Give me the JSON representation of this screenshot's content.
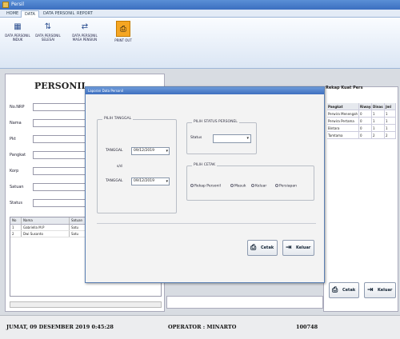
{
  "window": {
    "title": "Persil"
  },
  "tabs": [
    "HOME",
    "DATA",
    "DATA PERSONIL",
    "REPORT"
  ],
  "ribbon": {
    "buttons": [
      {
        "label": "DATA PERSONIL",
        "sub": "INDUK",
        "icon": "grid-icon"
      },
      {
        "label": "DATA PERSONIL",
        "sub": "SELESAI",
        "icon": "sort-icon"
      },
      {
        "label": "DATA PERSONIL",
        "sub": "MASA PENSIUN",
        "icon": "swap-icon"
      },
      {
        "label": "PRINT OUT",
        "sub": "",
        "icon": "printer-icon"
      }
    ]
  },
  "left_panel": {
    "title": "PERSONIL",
    "fields": [
      "No.NRP",
      "Nama",
      "Pkt",
      "Pangkat",
      "Korp",
      "Satuan",
      "Status"
    ],
    "grid": {
      "columns": [
        "No",
        "Nama",
        "Satuan"
      ],
      "rows": [
        [
          "1",
          "Gabriella M.P",
          "Satu"
        ],
        [
          "2",
          "Dwi Susanto",
          "Satu"
        ]
      ]
    }
  },
  "right_panel": {
    "title": "Rekap Kuat Pers",
    "columns": [
      "Pangkat",
      "Riwayat",
      "Dinas",
      "Jml"
    ],
    "rows": [
      [
        "Perwira Menengah",
        "0",
        "1",
        "1"
      ],
      [
        "Perwira Pertama",
        "0",
        "1",
        "1"
      ],
      [
        "Bintara",
        "0",
        "1",
        "1"
      ],
      [
        "Tamtama",
        "0",
        "2",
        "2"
      ]
    ],
    "print_label": "Cetak",
    "exit_label": "Keluar"
  },
  "dialog": {
    "title": "Laporan Data Personil",
    "date_group": "PILIH TANGGAL",
    "from_label": "TANGGAL",
    "from_value": "09/12/2019",
    "sd_label": "s/d",
    "to_label": "TANGGAL",
    "to_value": "09/12/2019",
    "status_group": "PILIH STATUS PERSONEL",
    "status_label": "Status",
    "status_value": "",
    "print_group": "PILIH CETAK",
    "print_options": [
      "Rekap Personil",
      "Masuk",
      "Keluar",
      "Persiapan"
    ],
    "print_label": "Cetak",
    "exit_label": "Keluar"
  },
  "statusbar": {
    "datetime": "JUMAT, 09 DESEMBER 2019  0:45:28",
    "operator": "OPERATOR : MINARTO",
    "code": "100748"
  }
}
